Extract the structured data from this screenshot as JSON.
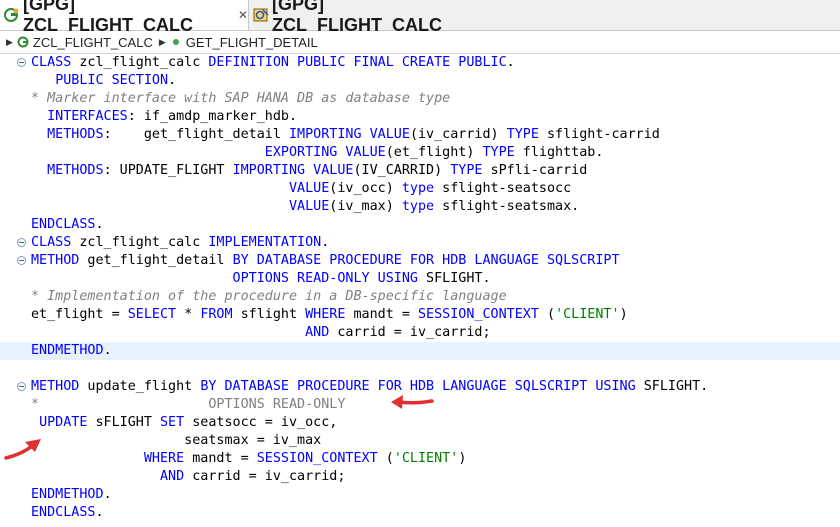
{
  "tabs": [
    {
      "label": "[GPG] ZCL_FLIGHT_CALC",
      "close": "✕",
      "active": true
    },
    {
      "label": "[GPG] ZCL_FLIGHT_CALC",
      "active": false
    }
  ],
  "breadcrumb": {
    "class_name": "ZCL_FLIGHT_CALC",
    "method_name": "GET_FLIGHT_DETAIL"
  },
  "code_lines": [
    {
      "fold": true,
      "hl": false,
      "tokens": [
        {
          "t": "kw",
          "v": "CLASS"
        },
        {
          "t": "tx",
          "v": " zcl_flight_calc "
        },
        {
          "t": "kw",
          "v": "DEFINITION PUBLIC FINAL CREATE PUBLIC"
        },
        {
          "t": "tx",
          "v": "."
        }
      ]
    },
    {
      "fold": false,
      "hl": false,
      "tokens": [
        {
          "t": "tx",
          "v": "   "
        },
        {
          "t": "kw",
          "v": "PUBLIC SECTION"
        },
        {
          "t": "tx",
          "v": "."
        }
      ]
    },
    {
      "fold": false,
      "hl": false,
      "tokens": [
        {
          "t": "cm",
          "v": "* Marker interface with SAP HANA DB as database type"
        }
      ]
    },
    {
      "fold": false,
      "hl": false,
      "tokens": [
        {
          "t": "tx",
          "v": "  "
        },
        {
          "t": "kw",
          "v": "INTERFACES"
        },
        {
          "t": "tx",
          "v": ": if_amdp_marker_hdb."
        }
      ]
    },
    {
      "fold": false,
      "hl": false,
      "tokens": [
        {
          "t": "tx",
          "v": "  "
        },
        {
          "t": "kw",
          "v": "METHODS"
        },
        {
          "t": "tx",
          "v": ":    get_flight_detail "
        },
        {
          "t": "kw",
          "v": "IMPORTING VALUE"
        },
        {
          "t": "tx",
          "v": "(iv_carrid) "
        },
        {
          "t": "kw",
          "v": "TYPE"
        },
        {
          "t": "tx",
          "v": " sflight-carrid"
        }
      ]
    },
    {
      "fold": false,
      "hl": false,
      "tokens": [
        {
          "t": "tx",
          "v": "                             "
        },
        {
          "t": "kw",
          "v": "EXPORTING VALUE"
        },
        {
          "t": "tx",
          "v": "(et_flight) "
        },
        {
          "t": "kw",
          "v": "TYPE"
        },
        {
          "t": "tx",
          "v": " flighttab."
        }
      ]
    },
    {
      "fold": false,
      "hl": false,
      "tokens": [
        {
          "t": "tx",
          "v": "  "
        },
        {
          "t": "kw",
          "v": "METHODS"
        },
        {
          "t": "tx",
          "v": ": UPDATE_FLIGHT "
        },
        {
          "t": "kw",
          "v": "IMPORTING VALUE"
        },
        {
          "t": "tx",
          "v": "(IV_CARRID) "
        },
        {
          "t": "kw",
          "v": "TYPE"
        },
        {
          "t": "tx",
          "v": " sPfli-carrid"
        }
      ]
    },
    {
      "fold": false,
      "hl": false,
      "tokens": [
        {
          "t": "tx",
          "v": "                                "
        },
        {
          "t": "kw",
          "v": "VALUE"
        },
        {
          "t": "tx",
          "v": "(iv_occ) "
        },
        {
          "t": "kw",
          "v": "type"
        },
        {
          "t": "tx",
          "v": " sflight-seatsocc"
        }
      ]
    },
    {
      "fold": false,
      "hl": false,
      "tokens": [
        {
          "t": "tx",
          "v": "                                "
        },
        {
          "t": "kw",
          "v": "VALUE"
        },
        {
          "t": "tx",
          "v": "(iv_max) "
        },
        {
          "t": "kw",
          "v": "type"
        },
        {
          "t": "tx",
          "v": " sflight-seatsmax."
        }
      ]
    },
    {
      "fold": false,
      "hl": false,
      "tokens": [
        {
          "t": "kw",
          "v": "ENDCLASS"
        },
        {
          "t": "tx",
          "v": "."
        }
      ]
    },
    {
      "fold": true,
      "hl": false,
      "tokens": [
        {
          "t": "kw",
          "v": "CLASS"
        },
        {
          "t": "tx",
          "v": " zcl_flight_calc "
        },
        {
          "t": "kw",
          "v": "IMPLEMENTATION"
        },
        {
          "t": "tx",
          "v": "."
        }
      ]
    },
    {
      "fold": true,
      "hl": false,
      "tokens": [
        {
          "t": "kw",
          "v": "METHOD"
        },
        {
          "t": "tx",
          "v": " get_flight_detail "
        },
        {
          "t": "kw",
          "v": "BY DATABASE PROCEDURE FOR HDB LANGUAGE SQLSCRIPT"
        }
      ]
    },
    {
      "fold": false,
      "hl": false,
      "tokens": [
        {
          "t": "tx",
          "v": "                         "
        },
        {
          "t": "kw",
          "v": "OPTIONS READ-ONLY USING"
        },
        {
          "t": "tx",
          "v": " SFLIGHT."
        }
      ]
    },
    {
      "fold": false,
      "hl": false,
      "tokens": [
        {
          "t": "cm",
          "v": "* Implementation of the procedure in a DB-specific language"
        }
      ]
    },
    {
      "fold": false,
      "hl": false,
      "tokens": [
        {
          "t": "tx",
          "v": "et_flight = "
        },
        {
          "t": "kw",
          "v": "SELECT"
        },
        {
          "t": "tx",
          "v": " * "
        },
        {
          "t": "kw",
          "v": "FROM"
        },
        {
          "t": "tx",
          "v": " sflight "
        },
        {
          "t": "kw",
          "v": "WHERE"
        },
        {
          "t": "tx",
          "v": " mandt = "
        },
        {
          "t": "kw",
          "v": "SESSION_CONTEXT"
        },
        {
          "t": "tx",
          "v": " ("
        },
        {
          "t": "st",
          "v": "'CLIENT'"
        },
        {
          "t": "tx",
          "v": ")"
        }
      ]
    },
    {
      "fold": false,
      "hl": false,
      "tokens": [
        {
          "t": "tx",
          "v": "                                  "
        },
        {
          "t": "kw",
          "v": "AND"
        },
        {
          "t": "tx",
          "v": " carrid = iv_carrid;"
        }
      ]
    },
    {
      "fold": false,
      "hl": true,
      "tokens": [
        {
          "t": "kw",
          "v": "ENDMETHOD"
        },
        {
          "t": "tx",
          "v": "."
        }
      ]
    },
    {
      "fold": false,
      "hl": false,
      "tokens": []
    },
    {
      "fold": true,
      "hl": false,
      "tokens": [
        {
          "t": "kw",
          "v": "METHOD"
        },
        {
          "t": "tx",
          "v": " update_flight "
        },
        {
          "t": "kw",
          "v": "BY DATABASE PROCEDURE FOR HDB LANGUAGE SQLSCRIPT USING"
        },
        {
          "t": "tx",
          "v": " SFLIGHT."
        }
      ]
    },
    {
      "fold": false,
      "hl": false,
      "tokens": [
        {
          "t": "cm2",
          "v": "*                     OPTIONS READ-ONLY"
        }
      ]
    },
    {
      "fold": false,
      "hl": false,
      "tokens": [
        {
          "t": "tx",
          "v": " "
        },
        {
          "t": "kw",
          "v": "UPDATE"
        },
        {
          "t": "tx",
          "v": " sFLIGHT "
        },
        {
          "t": "kw",
          "v": "SET"
        },
        {
          "t": "tx",
          "v": " seatsocc = iv_occ,"
        }
      ]
    },
    {
      "fold": false,
      "hl": false,
      "tokens": [
        {
          "t": "tx",
          "v": "                   seatsmax = iv_max"
        }
      ]
    },
    {
      "fold": false,
      "hl": false,
      "tokens": [
        {
          "t": "tx",
          "v": "              "
        },
        {
          "t": "kw",
          "v": "WHERE"
        },
        {
          "t": "tx",
          "v": " mandt = "
        },
        {
          "t": "kw",
          "v": "SESSION_CONTEXT"
        },
        {
          "t": "tx",
          "v": " ("
        },
        {
          "t": "st",
          "v": "'CLIENT'"
        },
        {
          "t": "tx",
          "v": ")"
        }
      ]
    },
    {
      "fold": false,
      "hl": false,
      "tokens": [
        {
          "t": "tx",
          "v": "                "
        },
        {
          "t": "kw",
          "v": "AND"
        },
        {
          "t": "tx",
          "v": " carrid = iv_carrid;"
        }
      ]
    },
    {
      "fold": false,
      "hl": false,
      "tokens": [
        {
          "t": "kw",
          "v": "ENDMETHOD"
        },
        {
          "t": "tx",
          "v": "."
        }
      ]
    },
    {
      "fold": false,
      "hl": false,
      "tokens": [
        {
          "t": "kw",
          "v": "ENDCLASS"
        },
        {
          "t": "tx",
          "v": "."
        }
      ]
    }
  ],
  "colors": {
    "keyword": "#0000ff",
    "comment": "#808080",
    "string": "#008000",
    "highlight": "#e8f2fe",
    "annotation_arrow": "#e03030"
  },
  "icons": {
    "tab_active": "abap-class-icon",
    "tab_inactive": "abap-class-edit-icon",
    "crumb_class": "class-icon",
    "crumb_method": "method-icon",
    "annotation": "red-arrow-icon"
  }
}
